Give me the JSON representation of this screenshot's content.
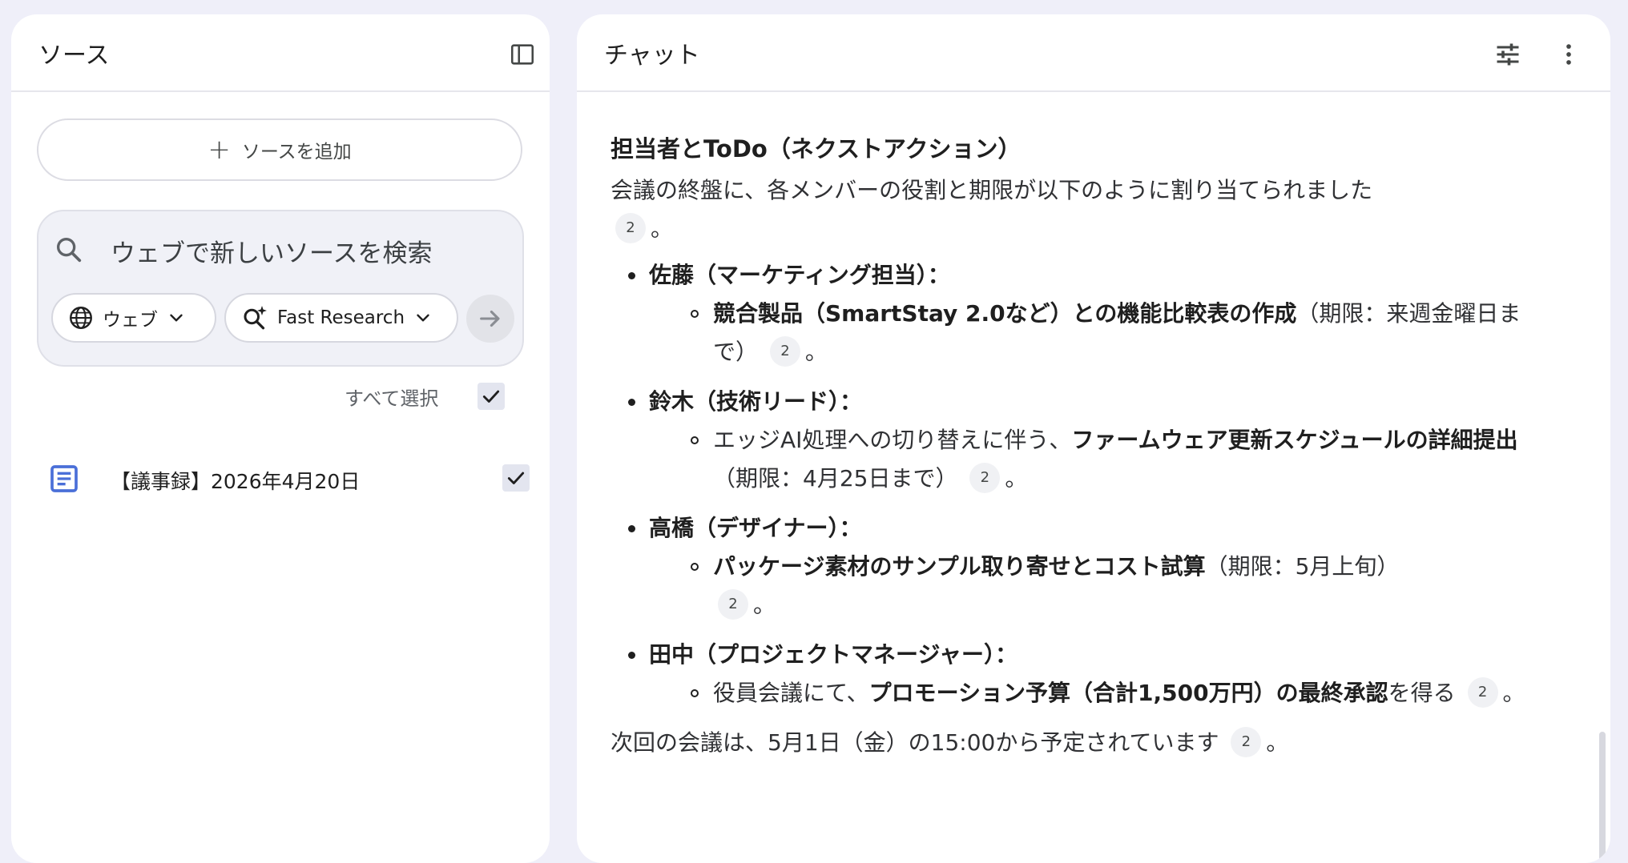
{
  "sources": {
    "title": "ソース",
    "add_source_label": "ソースを追加",
    "search_placeholder": "ウェブで新しいソースを検索",
    "web_chip_label": "ウェブ",
    "research_chip_label": "Fast Research",
    "select_all_label": "すべて選択",
    "items": [
      {
        "title": "【議事録】2026年4月20日",
        "checked": true
      }
    ]
  },
  "chat": {
    "title": "チャット",
    "heading": "担当者とToDo（ネクストアクション）",
    "intro": "会議の終盤に、各メンバーの役割と期限が以下のように割り当てられました",
    "cite_label": "2",
    "period": "。",
    "assignments": [
      {
        "person": "佐藤（マーケティング担当）：",
        "bold1": "競合製品（SmartStay 2.0など）との機能比較表の作成",
        "text1": "（期限：来週金曜日まで）"
      },
      {
        "person": "鈴木（技術リード）：",
        "text0": "エッジAI処理への切り替えに伴う、",
        "bold1": "ファームウェア更新スケジュールの詳細提出",
        "text1": "（期限：4月25日まで）"
      },
      {
        "person": "高橋（デザイナー）：",
        "bold1": "パッケージ素材のサンプル取り寄せとコスト試算",
        "text1": "（期限：5月上旬）"
      },
      {
        "person": "田中（プロジェクトマネージャー）：",
        "text0": "役員会議にて、",
        "bold1": "プロモーション予算（合計1,500万円）の最終承認",
        "text1": "を得る"
      }
    ],
    "closing": "次回の会議は、5月1日（金）の15:00から予定されています"
  },
  "colors": {
    "background": "#efeff9",
    "panel": "#ffffff",
    "doc_icon": "#4a6fd8",
    "checkbox": "#e3e5ef"
  },
  "icons": {
    "collapse_panel": "sidebar-panel-icon",
    "tune": "tune-icon",
    "more": "more-vert-icon",
    "search": "search-icon",
    "globe": "globe-icon",
    "research": "sparkle-search-icon",
    "doc": "document-icon"
  }
}
